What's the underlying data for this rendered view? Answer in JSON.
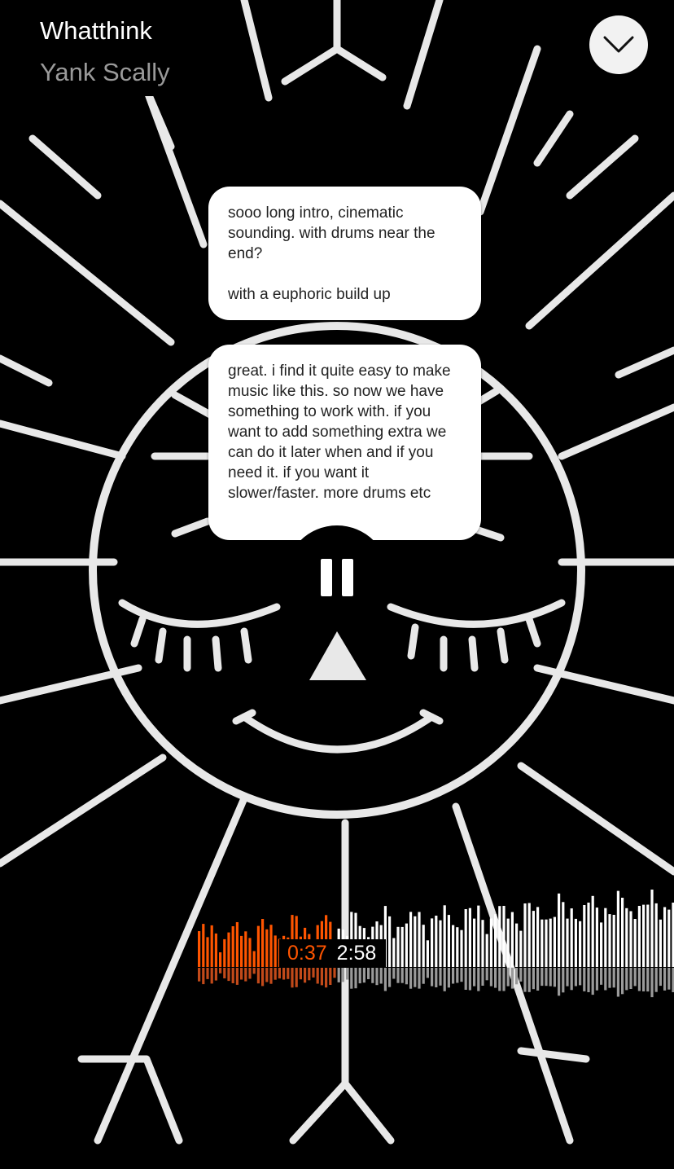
{
  "track": {
    "title": "Whatthink",
    "artist": "Yank Scally"
  },
  "comments": [
    {
      "text": "sooo long intro, cinematic sounding. with drums near the end?\n\nwith a euphoric build up"
    },
    {
      "text": "great. i find it quite easy to make music like this. so now we have something to work with. if you want to add something extra we can do it later when and if you need it. if you want it slower/faster. more drums etc"
    }
  ],
  "player": {
    "current_time": "0:37",
    "duration": "2:58",
    "progress_fraction": 0.208,
    "state": "playing",
    "play_button_icon": "pause-icon",
    "collapse_icon": "chevron-down-icon"
  },
  "colors": {
    "played": "#ff5500",
    "unplayed": "#ffffff",
    "reflection_played": "#c24a1a",
    "reflection_unplayed": "#9a9a9a"
  }
}
